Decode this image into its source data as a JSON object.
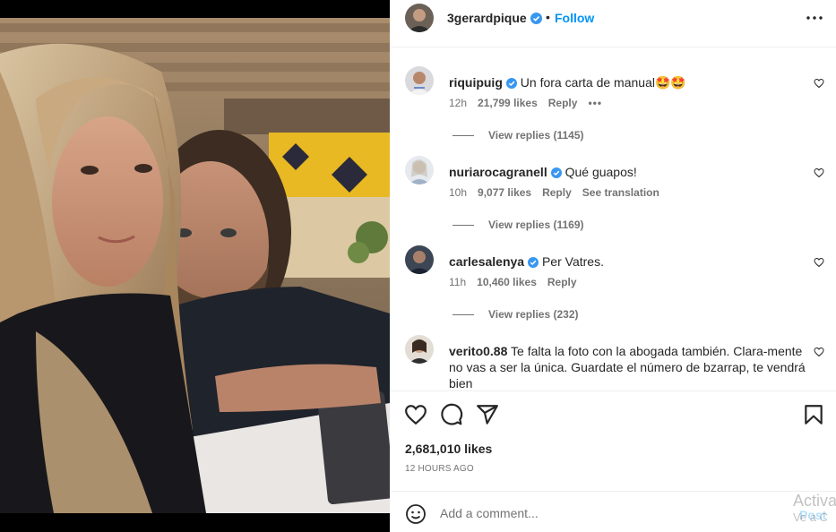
{
  "post": {
    "username": "3gerardpique",
    "follow_label": "Follow",
    "separator": "•",
    "likes": "2,681,010 likes",
    "time": "12 HOURS AGO"
  },
  "comments": [
    {
      "username": "riquipuig",
      "text": "Un fora carta de manual🤩🤩",
      "time": "12h",
      "likes": "21,799 likes",
      "reply": "Reply",
      "extra": "•••",
      "view_replies": "View replies (1145)"
    },
    {
      "username": "nuriarocagranell",
      "text": "Qué guapos!",
      "time": "10h",
      "likes": "9,077 likes",
      "reply": "Reply",
      "extra": "See translation",
      "view_replies": "View replies (1169)"
    },
    {
      "username": "carlesalenya",
      "text": "Per Vatres.",
      "time": "11h",
      "likes": "10,460 likes",
      "reply": "Reply",
      "view_replies": "View replies (232)"
    },
    {
      "username": "verito0.88",
      "text": "Te falta la foto con la abogada también. Clara-mente no vas a ser la única. Guardate el número de bzarrap, te vendrá bien"
    }
  ],
  "add_comment": {
    "placeholder": "Add a comment...",
    "post_label": "Post"
  },
  "watermark": {
    "line1": "Activa",
    "line2": "Ve a C"
  },
  "icons": {
    "verified": "verified-badge-icon",
    "more": "more-options-icon",
    "like": "heart-icon",
    "comment": "comment-icon",
    "share": "share-icon",
    "save": "bookmark-icon",
    "emoji": "emoji-icon"
  },
  "colors": {
    "accent": "#0095f6",
    "verified": "#3897f0",
    "muted": "#737373",
    "post_disabled": "#b2dffc"
  }
}
